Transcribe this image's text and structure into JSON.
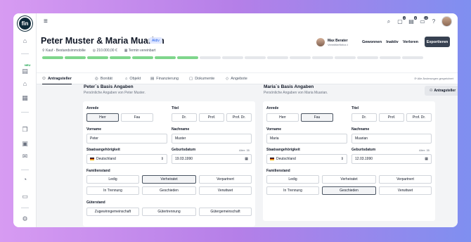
{
  "app": {
    "logo": "fin",
    "new_badge": "NEU"
  },
  "topbar": {
    "icons": [
      "menu-icon",
      "search-icon",
      "inbox-icon",
      "notes-icon",
      "chat-icon",
      "help-icon"
    ],
    "badges": {
      "inbox": "4",
      "notes": "8",
      "chat": "12"
    }
  },
  "header": {
    "title": "Peter Muster & Maria Muarian",
    "status": "Aktiv",
    "meta": [
      "Kauf - Bestandsimmobilie",
      "210.000,00 €",
      "Termin vereinbart"
    ],
    "progress": {
      "total": 17,
      "completed": 7
    },
    "advisor": {
      "name": "Max Berater",
      "role": "Vermittlerfinfox.t"
    },
    "actions": [
      "Gewonnen",
      "Inaktiv",
      "Verloren"
    ],
    "export_label": "Exportieren"
  },
  "tabs": [
    {
      "label": "Antragsteller",
      "active": true
    },
    {
      "label": "Bonität",
      "active": false
    },
    {
      "label": "Objekt",
      "active": false
    },
    {
      "label": "Finanzierung",
      "active": false
    },
    {
      "label": "Dokumente",
      "active": false
    },
    {
      "label": "Angebote",
      "active": false
    }
  ],
  "saved_text": "Alle Änderungen gespeichert",
  "colors": {
    "progress_done": "#7fd68c",
    "accent": "#374151",
    "status": "#2563eb"
  },
  "labels": {
    "anrede": "Anrede",
    "titel": "Titel",
    "vorname": "Vorname",
    "nachname": "Nachname",
    "staatsangehoerigkeit": "Staatsangehörigkeit",
    "geburtsdatum": "Geburtsdatum",
    "familienstand": "Familienstand",
    "gueterstand": "Güterstand",
    "add_applicant": "Antragsteller"
  },
  "options": {
    "anrede": [
      "Herr",
      "Fau"
    ],
    "titel": [
      "Dr.",
      "Prof.",
      "Prof. Dr."
    ],
    "familienstand": [
      "Ledig",
      "Verheiratet",
      "Verpartnert",
      "In Trennung",
      "Geschieden",
      "Verwitwet"
    ],
    "gueterstand": [
      "Zugewinngemeinschaft",
      "Gütertrennung",
      "Gütergemeinschaft"
    ]
  },
  "applicants": [
    {
      "heading": "Peter´s Basis Angaben",
      "subheading": "Persönliche Angaben von Peter Muster.",
      "anrede": "Herr",
      "vorname": "Peter",
      "nachname": "Muster",
      "nationality": "Deutschland",
      "birthdate": "19.03.1990",
      "age": "Alter: 35",
      "familienstand": "Verheiratet"
    },
    {
      "heading": "Maria´s Basis Angaben",
      "subheading": "Persönliche Angaben von Maria Muarian.",
      "anrede": "Fau",
      "vorname": "Maria",
      "nachname": "Muarian",
      "nationality": "Deutschland",
      "birthdate": "12.03.1990",
      "age": "Alter: 35",
      "familienstand": "Geschieden"
    }
  ]
}
